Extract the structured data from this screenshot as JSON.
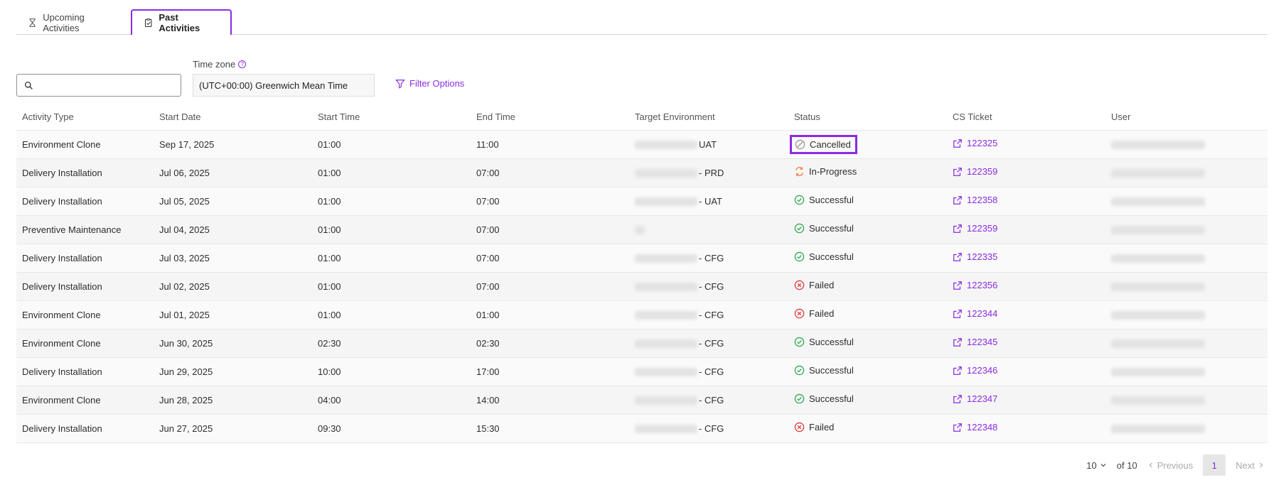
{
  "tabs": {
    "upcoming": "Upcoming Activities",
    "past": "Past Activities"
  },
  "timezone": {
    "label": "Time zone",
    "value": "(UTC+00:00) Greenwich Mean Time"
  },
  "search": {
    "placeholder": "",
    "value": ""
  },
  "filter_label": "Filter Options",
  "columns": [
    "Activity Type",
    "Start Date",
    "Start Time",
    "End Time",
    "Target Environment",
    "Status",
    "CS Ticket",
    "User"
  ],
  "rows": [
    {
      "type": "Environment Clone",
      "date": "Sep 17, 2025",
      "start": "01:00",
      "end": "11:00",
      "env": "UAT",
      "status": "Cancelled",
      "status_icon": "cancelled-icon",
      "ticket": "122325"
    },
    {
      "type": "Delivery Installation",
      "date": "Jul 06, 2025",
      "start": "01:00",
      "end": "07:00",
      "env": "- PRD",
      "status": "In-Progress",
      "status_icon": "in-progress-icon",
      "ticket": "122359"
    },
    {
      "type": "Delivery Installation",
      "date": "Jul 05, 2025",
      "start": "01:00",
      "end": "07:00",
      "env": "- UAT",
      "status": "Successful",
      "status_icon": "success-icon",
      "ticket": "122358"
    },
    {
      "type": "Preventive Maintenance",
      "date": "Jul 04, 2025",
      "start": "01:00",
      "end": "07:00",
      "env": "",
      "status": "Successful",
      "status_icon": "success-icon",
      "ticket": "122359"
    },
    {
      "type": "Delivery Installation",
      "date": "Jul 03, 2025",
      "start": "01:00",
      "end": "07:00",
      "env": "- CFG",
      "status": "Successful",
      "status_icon": "success-icon",
      "ticket": "122335"
    },
    {
      "type": "Delivery Installation",
      "date": "Jul 02, 2025",
      "start": "01:00",
      "end": "07:00",
      "env": "- CFG",
      "status": "Failed",
      "status_icon": "failed-icon",
      "ticket": "122356"
    },
    {
      "type": "Environment Clone",
      "date": "Jul 01, 2025",
      "start": "01:00",
      "end": "01:00",
      "env": "- CFG",
      "status": "Failed",
      "status_icon": "failed-icon",
      "ticket": "122344"
    },
    {
      "type": "Environment Clone",
      "date": "Jun 30, 2025",
      "start": "02:30",
      "end": "02:30",
      "env": "- CFG",
      "status": "Successful",
      "status_icon": "success-icon",
      "ticket": "122345"
    },
    {
      "type": "Delivery Installation",
      "date": "Jun 29, 2025",
      "start": "10:00",
      "end": "17:00",
      "env": "- CFG",
      "status": "Successful",
      "status_icon": "success-icon",
      "ticket": "122346"
    },
    {
      "type": "Environment Clone",
      "date": "Jun 28, 2025",
      "start": "04:00",
      "end": "14:00",
      "env": "- CFG",
      "status": "Successful",
      "status_icon": "success-icon",
      "ticket": "122347"
    },
    {
      "type": "Delivery Installation",
      "date": "Jun 27, 2025",
      "start": "09:30",
      "end": "15:30",
      "env": "- CFG",
      "status": "Failed",
      "status_icon": "failed-icon",
      "ticket": "122348"
    }
  ],
  "pagination": {
    "per_page": "10",
    "of_label": "of 10",
    "previous": "Previous",
    "current_page": "1",
    "next": "Next"
  },
  "colors": {
    "accent": "#8a2be2",
    "success": "#2fa84f",
    "failed": "#e03a3a",
    "in_progress": "#f07a3a",
    "cancelled": "#999999"
  }
}
